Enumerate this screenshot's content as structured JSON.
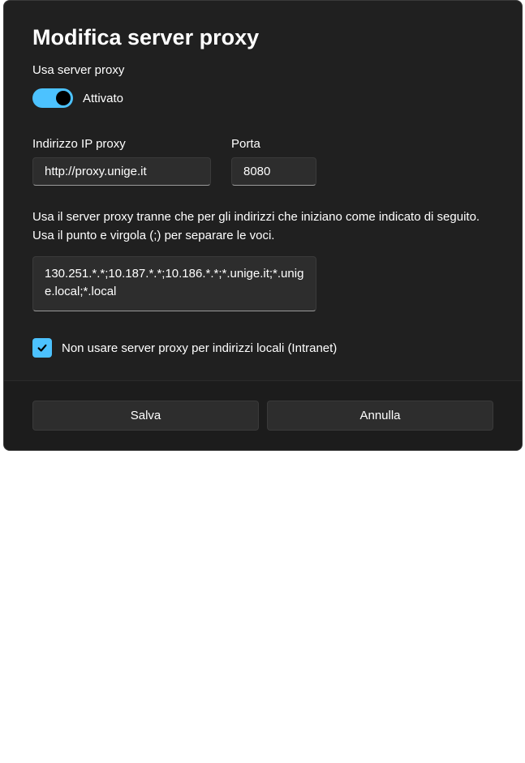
{
  "dialog": {
    "title": "Modifica server proxy",
    "use_proxy_label": "Usa server proxy",
    "toggle_state_label": "Attivato",
    "ip_label": "Indirizzo IP proxy",
    "ip_value": "http://proxy.unige.it",
    "port_label": "Porta",
    "port_value": "8080",
    "exceptions_description": "Usa il server proxy tranne che per gli indirizzi che iniziano come indicato di seguito. Usa il punto e virgola (;) per separare le voci.",
    "exceptions_value": "130.251.*.*;10.187.*.*;10.186.*.*;*.unige.it;*.unige.local;*.local",
    "local_bypass_label": "Non usare server proxy per indirizzi locali (Intranet)",
    "save_label": "Salva",
    "cancel_label": "Annulla"
  }
}
